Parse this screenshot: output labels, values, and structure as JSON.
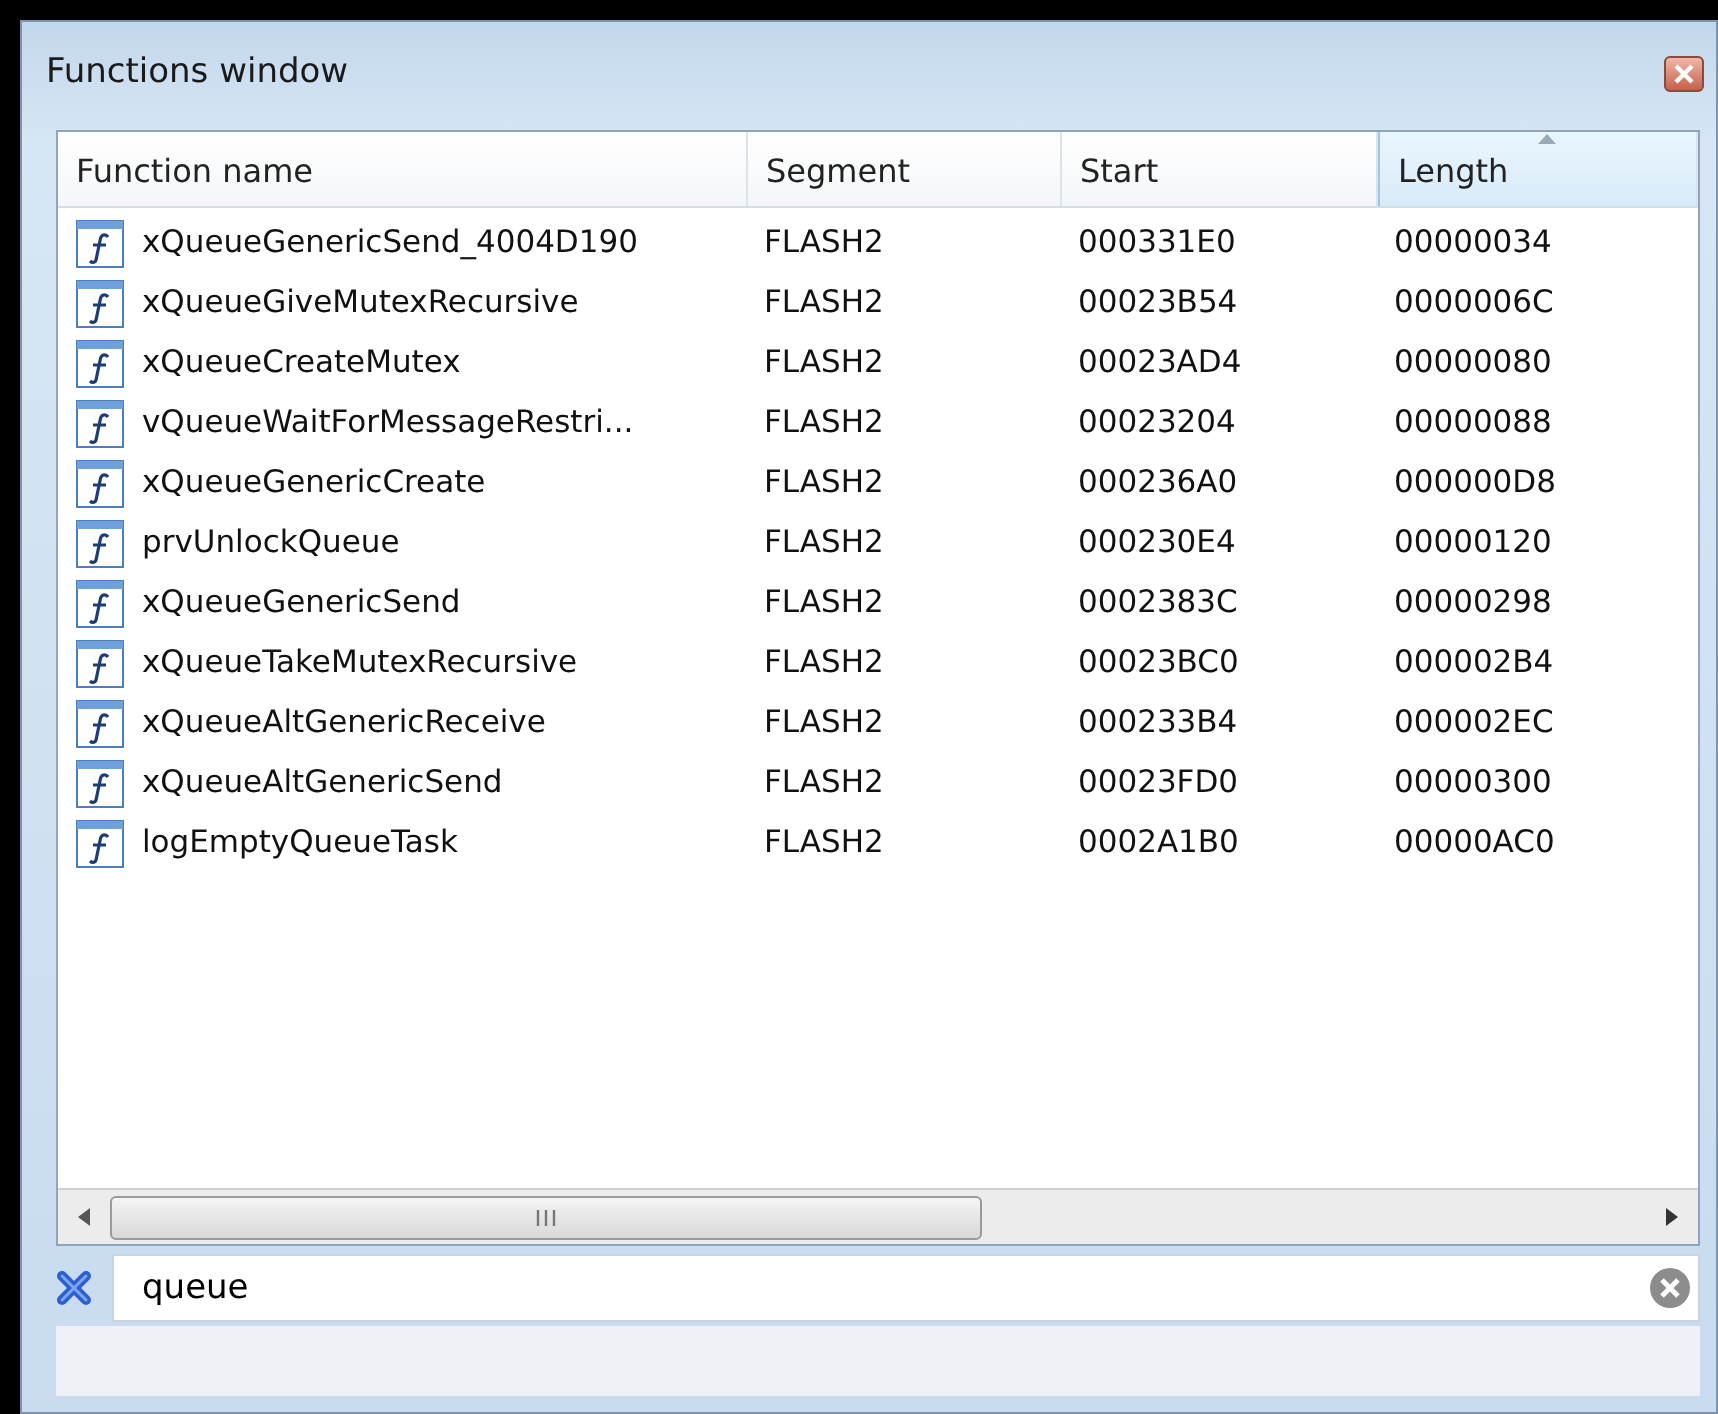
{
  "window": {
    "title": "Functions window"
  },
  "table": {
    "columns": [
      {
        "label": "Function name",
        "sorted": false
      },
      {
        "label": "Segment",
        "sorted": false
      },
      {
        "label": "Start",
        "sorted": false
      },
      {
        "label": "Length",
        "sorted": true
      }
    ],
    "rows": [
      {
        "name": "xQueueGenericSend_4004D190",
        "segment": "FLASH2",
        "start": "000331E0",
        "length": "00000034"
      },
      {
        "name": "xQueueGiveMutexRecursive",
        "segment": "FLASH2",
        "start": "00023B54",
        "length": "0000006C"
      },
      {
        "name": "xQueueCreateMutex",
        "segment": "FLASH2",
        "start": "00023AD4",
        "length": "00000080"
      },
      {
        "name": "vQueueWaitForMessageRestri...",
        "segment": "FLASH2",
        "start": "00023204",
        "length": "00000088"
      },
      {
        "name": "xQueueGenericCreate",
        "segment": "FLASH2",
        "start": "000236A0",
        "length": "000000D8"
      },
      {
        "name": "prvUnlockQueue",
        "segment": "FLASH2",
        "start": "000230E4",
        "length": "00000120"
      },
      {
        "name": "xQueueGenericSend",
        "segment": "FLASH2",
        "start": "0002383C",
        "length": "00000298"
      },
      {
        "name": "xQueueTakeMutexRecursive",
        "segment": "FLASH2",
        "start": "00023BC0",
        "length": "000002B4"
      },
      {
        "name": "xQueueAltGenericReceive",
        "segment": "FLASH2",
        "start": "000233B4",
        "length": "000002EC"
      },
      {
        "name": "xQueueAltGenericSend",
        "segment": "FLASH2",
        "start": "00023FD0",
        "length": "00000300"
      },
      {
        "name": "logEmptyQueueTask",
        "segment": "FLASH2",
        "start": "0002A1B0",
        "length": "00000AC0"
      }
    ]
  },
  "filter": {
    "value": "queue"
  }
}
